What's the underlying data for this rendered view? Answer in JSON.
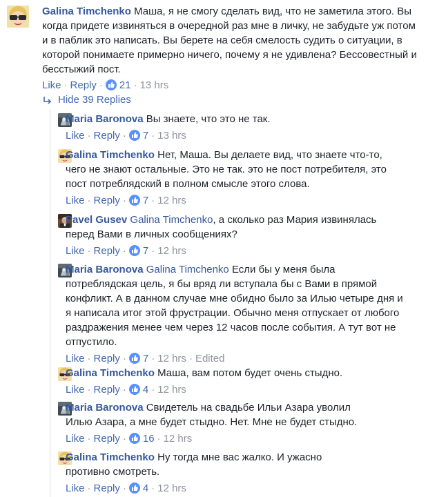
{
  "comments": [
    {
      "name": "Galina Timchenko",
      "mention": "",
      "text": "Маша, я не смогу сделать вид, что не заметила этого. Вы когда придете извиняться в очередной раз мне в личку, не забудьте уж потом и в паблик это написать. Вы берете на себя смелость судить о ситуации, в которой понимаете примерно ничего, почему я не удивлена? Бессовестный и бесстыжий пост.",
      "like": "Like",
      "reply": "Reply",
      "likes": "21",
      "time": "13 hrs",
      "edited": ""
    }
  ],
  "hide_replies": "Hide 39 Replies",
  "replies": [
    {
      "name": "Maria Baronova",
      "mention": "",
      "text": "Вы знаете, что это не так.",
      "like": "Like",
      "reply": "Reply",
      "likes": "7",
      "time": "13 hrs",
      "edited": ""
    },
    {
      "name": "Galina Timchenko",
      "mention": "",
      "text": "Нет, Маша. Вы делаете вид, что знаете что-то, чего не знают остальные. Это не так. это не пост потребителя, это пост потреблядский в полном смысле этого слова.",
      "like": "Like",
      "reply": "Reply",
      "likes": "7",
      "time": "12 hrs",
      "edited": ""
    },
    {
      "name": "Pavel Gusev",
      "mention": "Galina Timchenko",
      "text": ", а сколько раз Мария извинялась перед Вами в личных сообщениях?",
      "like": "Like",
      "reply": "Reply",
      "likes": "7",
      "time": "12 hrs",
      "edited": ""
    },
    {
      "name": "Maria Baronova",
      "mention": "Galina Timchenko",
      "text": "Если бы у меня была потреблядская цель, я бы вряд ли вступала бы с Вами в прямой конфликт. А в данном случае мне обидно было за Илью четыре дня и я написала итог этой фрустрации. Обычно меня отпускает от любого раздражения менее чем через 12 часов после события. А тут вот не отпустило.",
      "like": "Like",
      "reply": "Reply",
      "likes": "7",
      "time": "12 hrs",
      "edited": "Edited"
    },
    {
      "name": "Galina Timchenko",
      "mention": "",
      "text": "Маша, вам потом будет очень стыдно.",
      "like": "Like",
      "reply": "Reply",
      "likes": "4",
      "time": "12 hrs",
      "edited": ""
    },
    {
      "name": "Maria Baronova",
      "mention": "",
      "text": "Свидетель на свадьбе Ильи Азара уволил Илью Азара, а мне будет стыдно. Нет. Мне не будет стыдно.",
      "like": "Like",
      "reply": "Reply",
      "likes": "16",
      "time": "12 hrs",
      "edited": ""
    },
    {
      "name": "Galina Timchenko",
      "mention": "",
      "text": "Ну тогда мне вас жалко. И ужасно противно смотреть.",
      "like": "Like",
      "reply": "Reply",
      "likes": "4",
      "time": "12 hrs",
      "edited": ""
    }
  ],
  "colors": {
    "link": "#365899",
    "action": "#4267b2",
    "meta": "#90949c",
    "like_badge": "#5890ff"
  },
  "icons": {
    "like": "thumbs-up-icon",
    "hide": "corner-arrow-icon"
  }
}
